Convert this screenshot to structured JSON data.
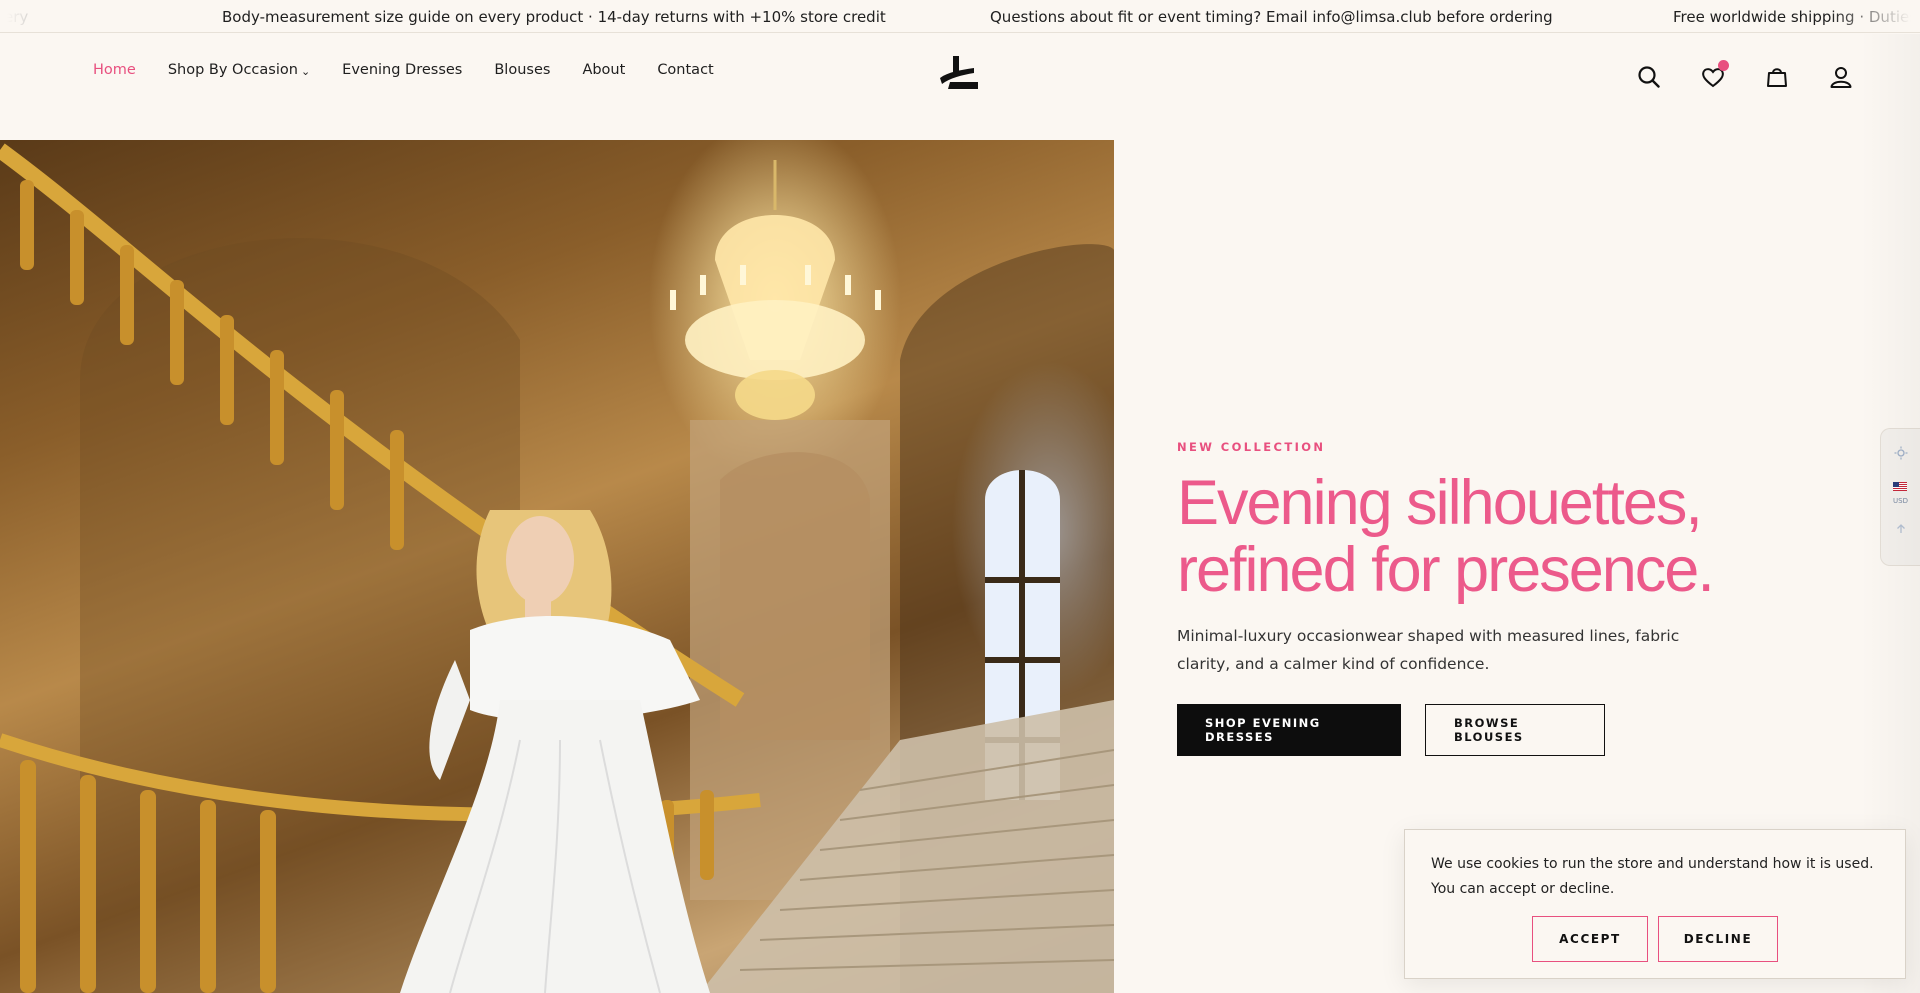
{
  "announcement": {
    "messages": [
      "ery",
      "Body-measurement size guide on every product · 14-day returns with +10% store credit",
      "Questions about fit or event timing? Email info@limsa.club before ordering",
      "Free worldwide shipping · Duties & t"
    ]
  },
  "nav": {
    "items": [
      {
        "label": "Home",
        "active": true
      },
      {
        "label": "Shop By Occasion",
        "has_dropdown": true
      },
      {
        "label": "Evening Dresses"
      },
      {
        "label": "Blouses"
      },
      {
        "label": "About"
      },
      {
        "label": "Contact"
      }
    ]
  },
  "header_icons": [
    "search-icon",
    "wishlist-icon",
    "bag-icon",
    "account-icon"
  ],
  "hero": {
    "eyebrow": "NEW COLLECTION",
    "headline_line1": "Evening silhouettes,",
    "headline_line2": "refined for presence.",
    "subtext": "Minimal-luxury occasionwear shaped with measured lines, fabric clarity, and a calmer kind of confidence.",
    "primary_cta": "SHOP EVENING DRESSES",
    "secondary_cta": "BROWSE BLOUSES"
  },
  "side_widget": {
    "currency": "USD",
    "icons": [
      "sun-icon",
      "us-flag-icon",
      "arrow-up-icon"
    ]
  },
  "cookie": {
    "text": "We use cookies to run the store and understand how it is used. You can accept or decline.",
    "accept": "ACCEPT",
    "decline": "DECLINE"
  },
  "colors": {
    "accent_pink": "#e8507f",
    "background": "#fbf7f2",
    "dark_button": "#0d0d0d"
  }
}
